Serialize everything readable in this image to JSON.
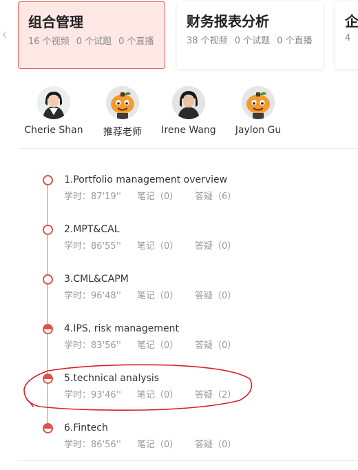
{
  "courses": [
    {
      "title": "组合管理",
      "videos": "16 个视频",
      "quizzes": "0 个试题",
      "live": "0 个直播"
    },
    {
      "title": "财务报表分析",
      "videos": "38 个视频",
      "quizzes": "0 个试题",
      "live": "0 个直播"
    },
    {
      "title": "企",
      "videos": "4"
    }
  ],
  "teachers": [
    {
      "name": "Cherie Shan"
    },
    {
      "name": "推荐老师"
    },
    {
      "name": "Irene Wang"
    },
    {
      "name": "Jaylon Gu"
    }
  ],
  "lessons": [
    {
      "title": "1.Portfolio management overview",
      "time": "学时：87'19''",
      "notes": "笔记（0）",
      "qa": "答疑（6）",
      "progress": "none"
    },
    {
      "title": "2.MPT&CAL",
      "time": "学时：86'55''",
      "notes": "笔记（0）",
      "qa": "答疑（0）",
      "progress": "none"
    },
    {
      "title": "3.CML&CAPM",
      "time": "学时：96'48''",
      "notes": "笔记（0）",
      "qa": "答疑（0）",
      "progress": "none"
    },
    {
      "title": "4.IPS, risk management",
      "time": "学时：83'56''",
      "notes": "笔记（0）",
      "qa": "答疑（0）",
      "progress": "partial"
    },
    {
      "title": "5.technical analysis",
      "time": "学时：93'46''",
      "notes": "笔记（0）",
      "qa": "答疑（2）",
      "progress": "partial"
    },
    {
      "title": "6.Fintech",
      "time": "学时：86'56''",
      "notes": "笔记（0）",
      "qa": "答疑（0）",
      "progress": "partial"
    }
  ],
  "colors": {
    "accent": "#e0514a",
    "active_card_bg": "#fde8e6",
    "annotation": "#d8202a"
  }
}
